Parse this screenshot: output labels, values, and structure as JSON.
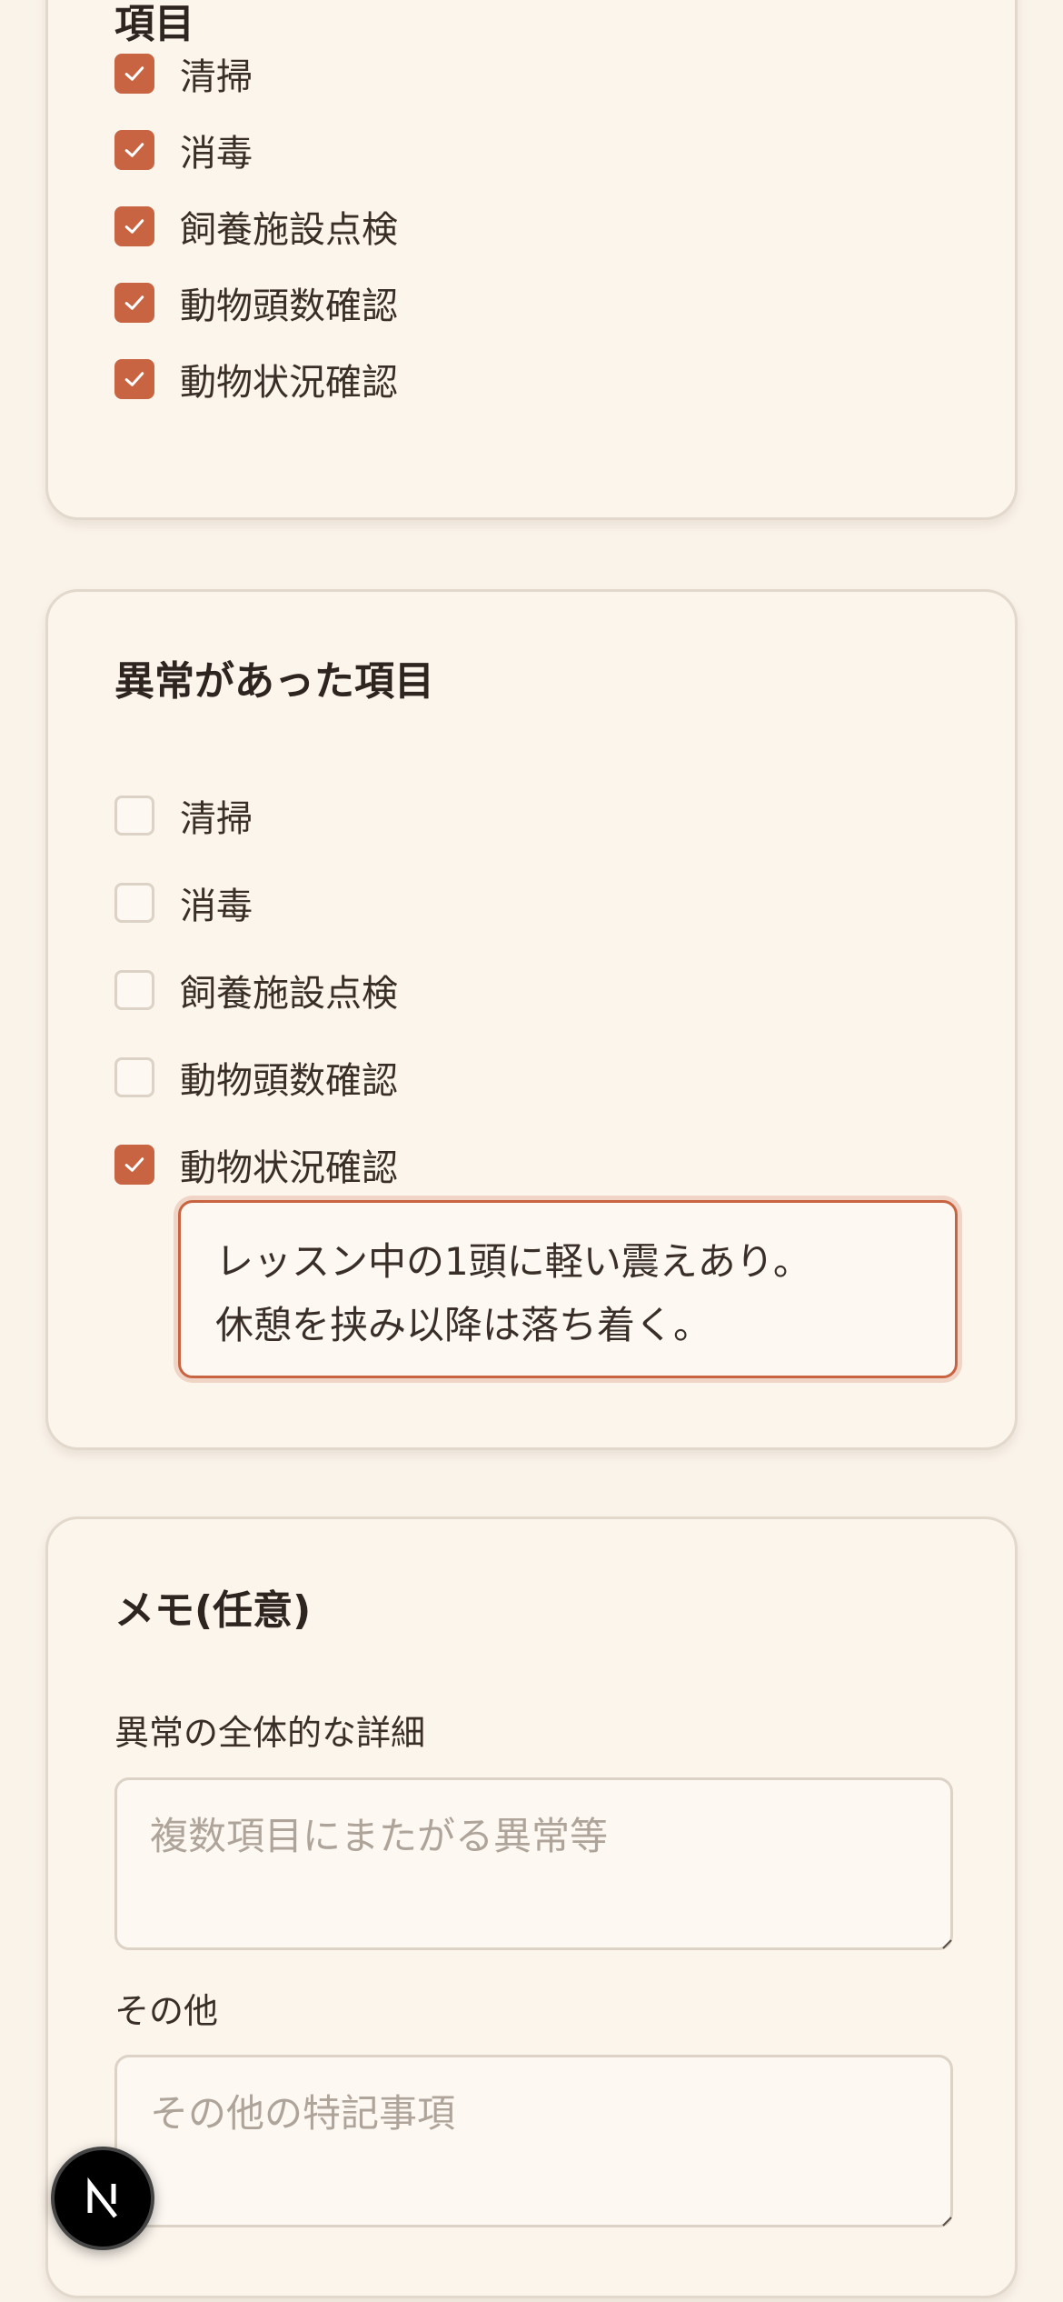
{
  "sections": {
    "performed": {
      "title_partial": "項目",
      "items": [
        {
          "label": "清掃",
          "checked": true
        },
        {
          "label": "消毒",
          "checked": true
        },
        {
          "label": "飼養施設点検",
          "checked": true
        },
        {
          "label": "動物頭数確認",
          "checked": true
        },
        {
          "label": "動物状況確認",
          "checked": true
        }
      ]
    },
    "abnormal": {
      "title": "異常があった項目",
      "items": [
        {
          "label": "清掃",
          "checked": false
        },
        {
          "label": "消毒",
          "checked": false
        },
        {
          "label": "飼養施設点検",
          "checked": false
        },
        {
          "label": "動物頭数確認",
          "checked": false
        },
        {
          "label": "動物状況確認",
          "checked": true
        }
      ],
      "detail_note": "レッスン中の1頭に軽い震えあり。\n休憩を挟み以降は落ち着く。"
    },
    "memo": {
      "title": "メモ(任意)",
      "overall_label": "異常の全体的な詳細",
      "overall_placeholder": "複数項目にまたがる異常等",
      "overall_value": "",
      "other_label": "その他",
      "other_placeholder": "その他の特記事項",
      "other_value": ""
    }
  },
  "colors": {
    "accent": "#c96443",
    "background": "#faf3ea",
    "card": "#fcf5ec",
    "border": "#e2d8cc"
  },
  "badge": {
    "icon": "nextjs-icon",
    "letter": "N"
  }
}
